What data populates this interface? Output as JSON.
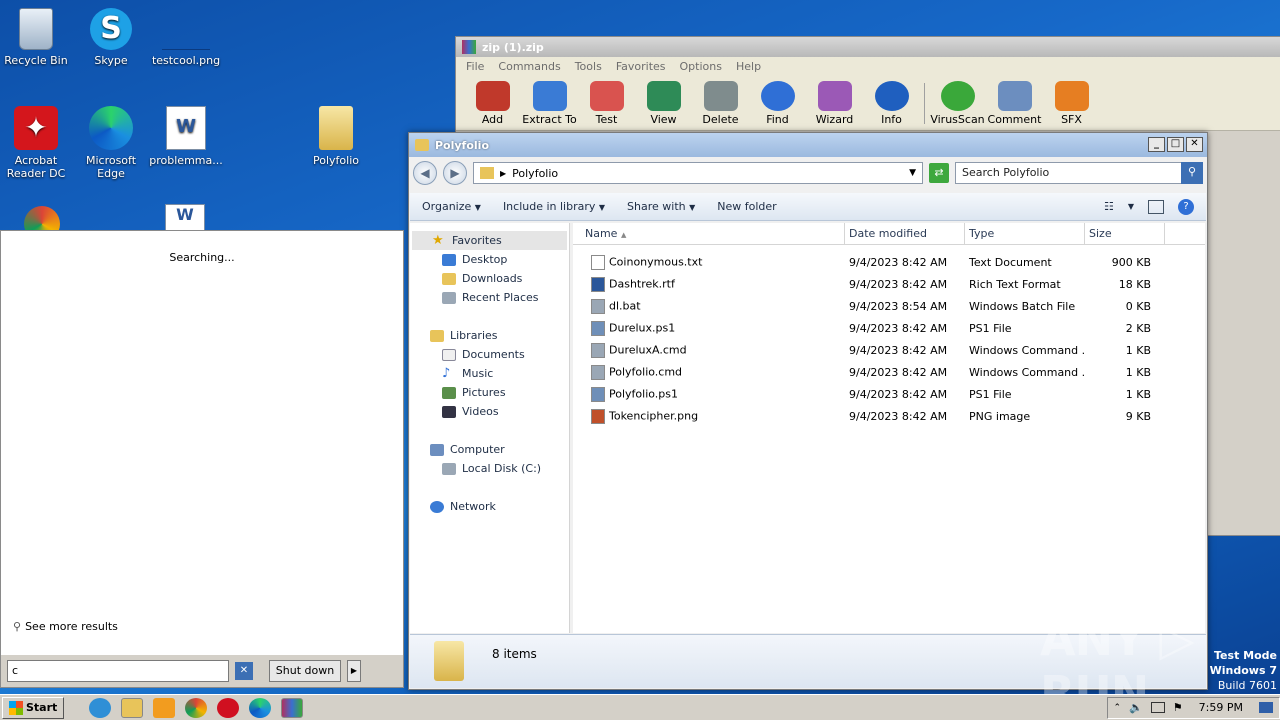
{
  "desktop": {
    "icons": [
      {
        "label": "Recycle Bin",
        "icon": "recycle-bin-icon"
      },
      {
        "label": "Skype",
        "icon": "skype-icon"
      },
      {
        "label": "testcool.png",
        "icon": "image-file-icon"
      },
      {
        "label": "Acrobat Reader DC",
        "icon": "acrobat-icon"
      },
      {
        "label": "Microsoft Edge",
        "icon": "edge-icon"
      },
      {
        "label": "problemma...",
        "icon": "word-doc-icon"
      },
      {
        "label": "Polyfolio",
        "icon": "folder-icon"
      }
    ],
    "watermark": {
      "brand": "ANY ▷ RUN",
      "test_mode": "Test Mode",
      "os": "Windows 7",
      "build": "Build 7601"
    }
  },
  "winrar": {
    "title": "zip (1).zip",
    "menu": [
      "File",
      "Commands",
      "Tools",
      "Favorites",
      "Options",
      "Help"
    ],
    "toolbar": [
      {
        "label": "Add",
        "color": "#c0392b"
      },
      {
        "label": "Extract To",
        "color": "#3a7bd5"
      },
      {
        "label": "Test",
        "color": "#d9534f"
      },
      {
        "label": "View",
        "color": "#2e8b57"
      },
      {
        "label": "Delete",
        "color": "#7f8c8d"
      },
      {
        "label": "Find",
        "color": "#2f6fd6"
      },
      {
        "label": "Wizard",
        "color": "#9b59b6"
      },
      {
        "label": "Info",
        "color": "#1f5fbf"
      },
      {
        "label": "VirusScan",
        "color": "#3aa83a"
      },
      {
        "label": "Comment",
        "color": "#6c8ebf"
      },
      {
        "label": "SFX",
        "color": "#e67e22"
      }
    ]
  },
  "explorer": {
    "title": "Polyfolio",
    "window_buttons": {
      "minimize": "_",
      "maximize": "□",
      "close": "✕"
    },
    "address": "Polyfolio",
    "search_placeholder": "Search Polyfolio",
    "commands": [
      "Organize",
      "Include in library",
      "Share with",
      "New folder"
    ],
    "nav": {
      "favorites": {
        "label": "Favorites",
        "items": [
          "Desktop",
          "Downloads",
          "Recent Places"
        ]
      },
      "libraries": {
        "label": "Libraries",
        "items": [
          "Documents",
          "Music",
          "Pictures",
          "Videos"
        ]
      },
      "computer": {
        "label": "Computer",
        "items": [
          "Local Disk (C:)"
        ]
      },
      "network": {
        "label": "Network"
      }
    },
    "columns": [
      "Name",
      "Date modified",
      "Type",
      "Size"
    ],
    "files": [
      {
        "name": "Coinonymous.txt",
        "date": "9/4/2023 8:42 AM",
        "type": "Text Document",
        "size": "900 KB",
        "icon_color": "#ffffff"
      },
      {
        "name": "Dashtrek.rtf",
        "date": "9/4/2023 8:42 AM",
        "type": "Rich Text Format",
        "size": "18 KB",
        "icon_color": "#2b579a"
      },
      {
        "name": "dl.bat",
        "date": "9/4/2023 8:54 AM",
        "type": "Windows Batch File",
        "size": "0 KB",
        "icon_color": "#9aa7b5"
      },
      {
        "name": "Durelux.ps1",
        "date": "9/4/2023 8:42 AM",
        "type": "PS1 File",
        "size": "2 KB",
        "icon_color": "#6f8fb8"
      },
      {
        "name": "DureluxA.cmd",
        "date": "9/4/2023 8:42 AM",
        "type": "Windows Command ...",
        "size": "1 KB",
        "icon_color": "#9aa7b5"
      },
      {
        "name": "Polyfolio.cmd",
        "date": "9/4/2023 8:42 AM",
        "type": "Windows Command ...",
        "size": "1 KB",
        "icon_color": "#9aa7b5"
      },
      {
        "name": "Polyfolio.ps1",
        "date": "9/4/2023 8:42 AM",
        "type": "PS1 File",
        "size": "1 KB",
        "icon_color": "#6f8fb8"
      },
      {
        "name": "Tokencipher.png",
        "date": "9/4/2023 8:42 AM",
        "type": "PNG image",
        "size": "9 KB",
        "icon_color": "#c0502a"
      }
    ],
    "item_count": "8 items"
  },
  "start_search": {
    "status": "Searching...",
    "see_more": "See more results",
    "query": "c",
    "clear_icon": "✕",
    "shutdown_label": "Shut down",
    "shutdown_arrow": "▶"
  },
  "taskbar": {
    "start_label": "Start",
    "clock": "7:59 PM"
  }
}
